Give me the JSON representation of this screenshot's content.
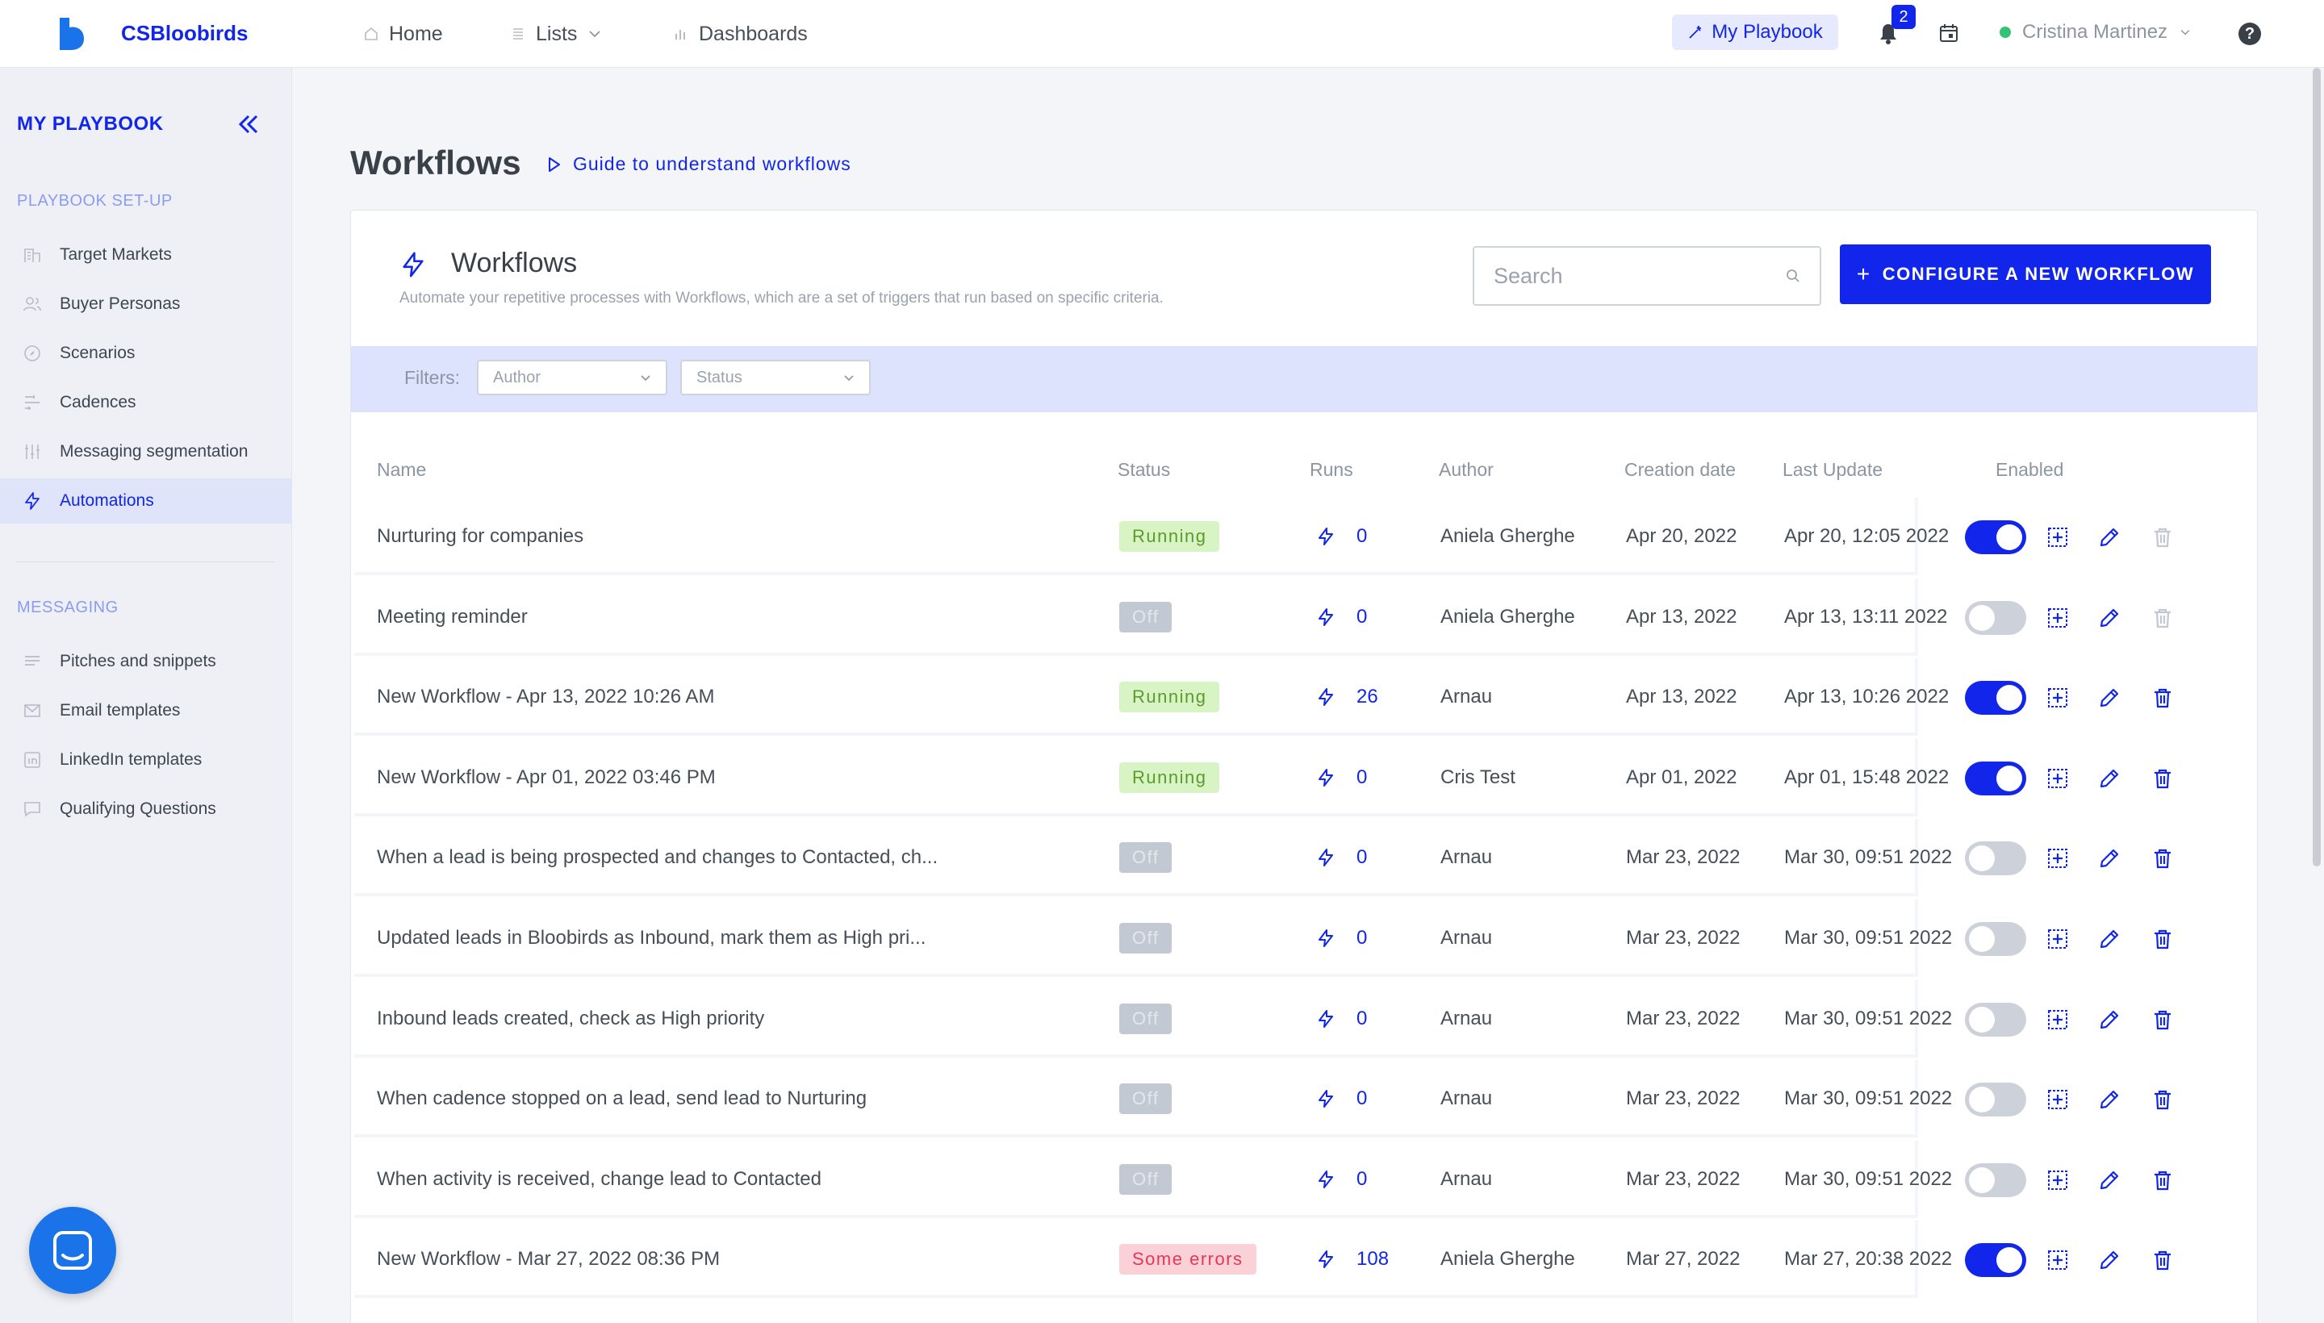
{
  "app": {
    "brand": "CSBloobirds",
    "nav": [
      {
        "label": "Home",
        "icon": "home-icon"
      },
      {
        "label": "Lists",
        "icon": "list-icon"
      },
      {
        "label": "Dashboards",
        "icon": "bar-chart-icon"
      }
    ],
    "playbook_button": "My Playbook",
    "notifications_count": "2",
    "user_name": "Cristina Martinez",
    "help_label": "?",
    "accent_color": "#1126ea"
  },
  "sidebar": {
    "title": "MY PLAYBOOK",
    "section_setup": "PLAYBOOK SET-UP",
    "setup_items": [
      {
        "label": "Target Markets",
        "icon": "building-icon"
      },
      {
        "label": "Buyer Personas",
        "icon": "users-icon"
      },
      {
        "label": "Scenarios",
        "icon": "compass-icon"
      },
      {
        "label": "Cadences",
        "icon": "cadence-icon"
      },
      {
        "label": "Messaging segmentation",
        "icon": "sliders-icon"
      },
      {
        "label": "Automations",
        "icon": "bolt-icon",
        "active": true
      }
    ],
    "section_messaging": "MESSAGING",
    "messaging_items": [
      {
        "label": "Pitches and snippets",
        "icon": "lines-icon"
      },
      {
        "label": "Email templates",
        "icon": "mail-icon"
      },
      {
        "label": "LinkedIn templates",
        "icon": "linkedin-icon"
      },
      {
        "label": "Qualifying Questions",
        "icon": "chat-icon"
      }
    ]
  },
  "main": {
    "page_title": "Workflows",
    "guide_link": "Guide to understand workflows",
    "card_title": "Workflows",
    "card_subtitle": "Automate your repetitive processes with Workflows, which are a set of triggers that run based on specific criteria.",
    "search_placeholder": "Search",
    "configure_button": "CONFIGURE A NEW WORKFLOW",
    "filters_label": "Filters:",
    "filter_author": "Author",
    "filter_status": "Status",
    "columns": [
      "Name",
      "Status",
      "Runs",
      "Author",
      "Creation date",
      "Last Update",
      "Enabled"
    ],
    "rows": [
      {
        "name": "Nurturing for companies",
        "status": "Running",
        "runs": "0",
        "author": "Aniela Gherghe",
        "created": "Apr 20, 2022",
        "updated": "Apr 20, 12:05 2022",
        "enabled": true,
        "delete_enabled": false
      },
      {
        "name": "Meeting reminder",
        "status": "Off",
        "runs": "0",
        "author": "Aniela Gherghe",
        "created": "Apr 13, 2022",
        "updated": "Apr 13, 13:11 2022",
        "enabled": false,
        "delete_enabled": false
      },
      {
        "name": "New Workflow - Apr 13, 2022 10:26 AM",
        "status": "Running",
        "runs": "26",
        "author": "Arnau",
        "created": "Apr 13, 2022",
        "updated": "Apr 13, 10:26 2022",
        "enabled": true,
        "delete_enabled": true
      },
      {
        "name": "New Workflow - Apr 01, 2022 03:46 PM",
        "status": "Running",
        "runs": "0",
        "author": "Cris Test",
        "created": "Apr 01, 2022",
        "updated": "Apr 01, 15:48 2022",
        "enabled": true,
        "delete_enabled": true
      },
      {
        "name": "When a lead is being prospected and changes to Contacted, ch...",
        "status": "Off",
        "runs": "0",
        "author": "Arnau",
        "created": "Mar 23, 2022",
        "updated": "Mar 30, 09:51 2022",
        "enabled": false,
        "delete_enabled": true
      },
      {
        "name": "Updated leads in Bloobirds as Inbound, mark them as High pri...",
        "status": "Off",
        "runs": "0",
        "author": "Arnau",
        "created": "Mar 23, 2022",
        "updated": "Mar 30, 09:51 2022",
        "enabled": false,
        "delete_enabled": true
      },
      {
        "name": "Inbound leads created, check as High priority",
        "status": "Off",
        "runs": "0",
        "author": "Arnau",
        "created": "Mar 23, 2022",
        "updated": "Mar 30, 09:51 2022",
        "enabled": false,
        "delete_enabled": true
      },
      {
        "name": "When cadence stopped on a lead, send lead to Nurturing",
        "status": "Off",
        "runs": "0",
        "author": "Arnau",
        "created": "Mar 23, 2022",
        "updated": "Mar 30, 09:51 2022",
        "enabled": false,
        "delete_enabled": true
      },
      {
        "name": "When activity is received, change lead to Contacted",
        "status": "Off",
        "runs": "0",
        "author": "Arnau",
        "created": "Mar 23, 2022",
        "updated": "Mar 30, 09:51 2022",
        "enabled": false,
        "delete_enabled": true
      },
      {
        "name": "New Workflow - Mar 27, 2022 08:36 PM",
        "status": "Some errors",
        "runs": "108",
        "author": "Aniela Gherghe",
        "created": "Mar 27, 2022",
        "updated": "Mar 27, 20:38 2022",
        "enabled": true,
        "delete_enabled": true
      }
    ]
  }
}
